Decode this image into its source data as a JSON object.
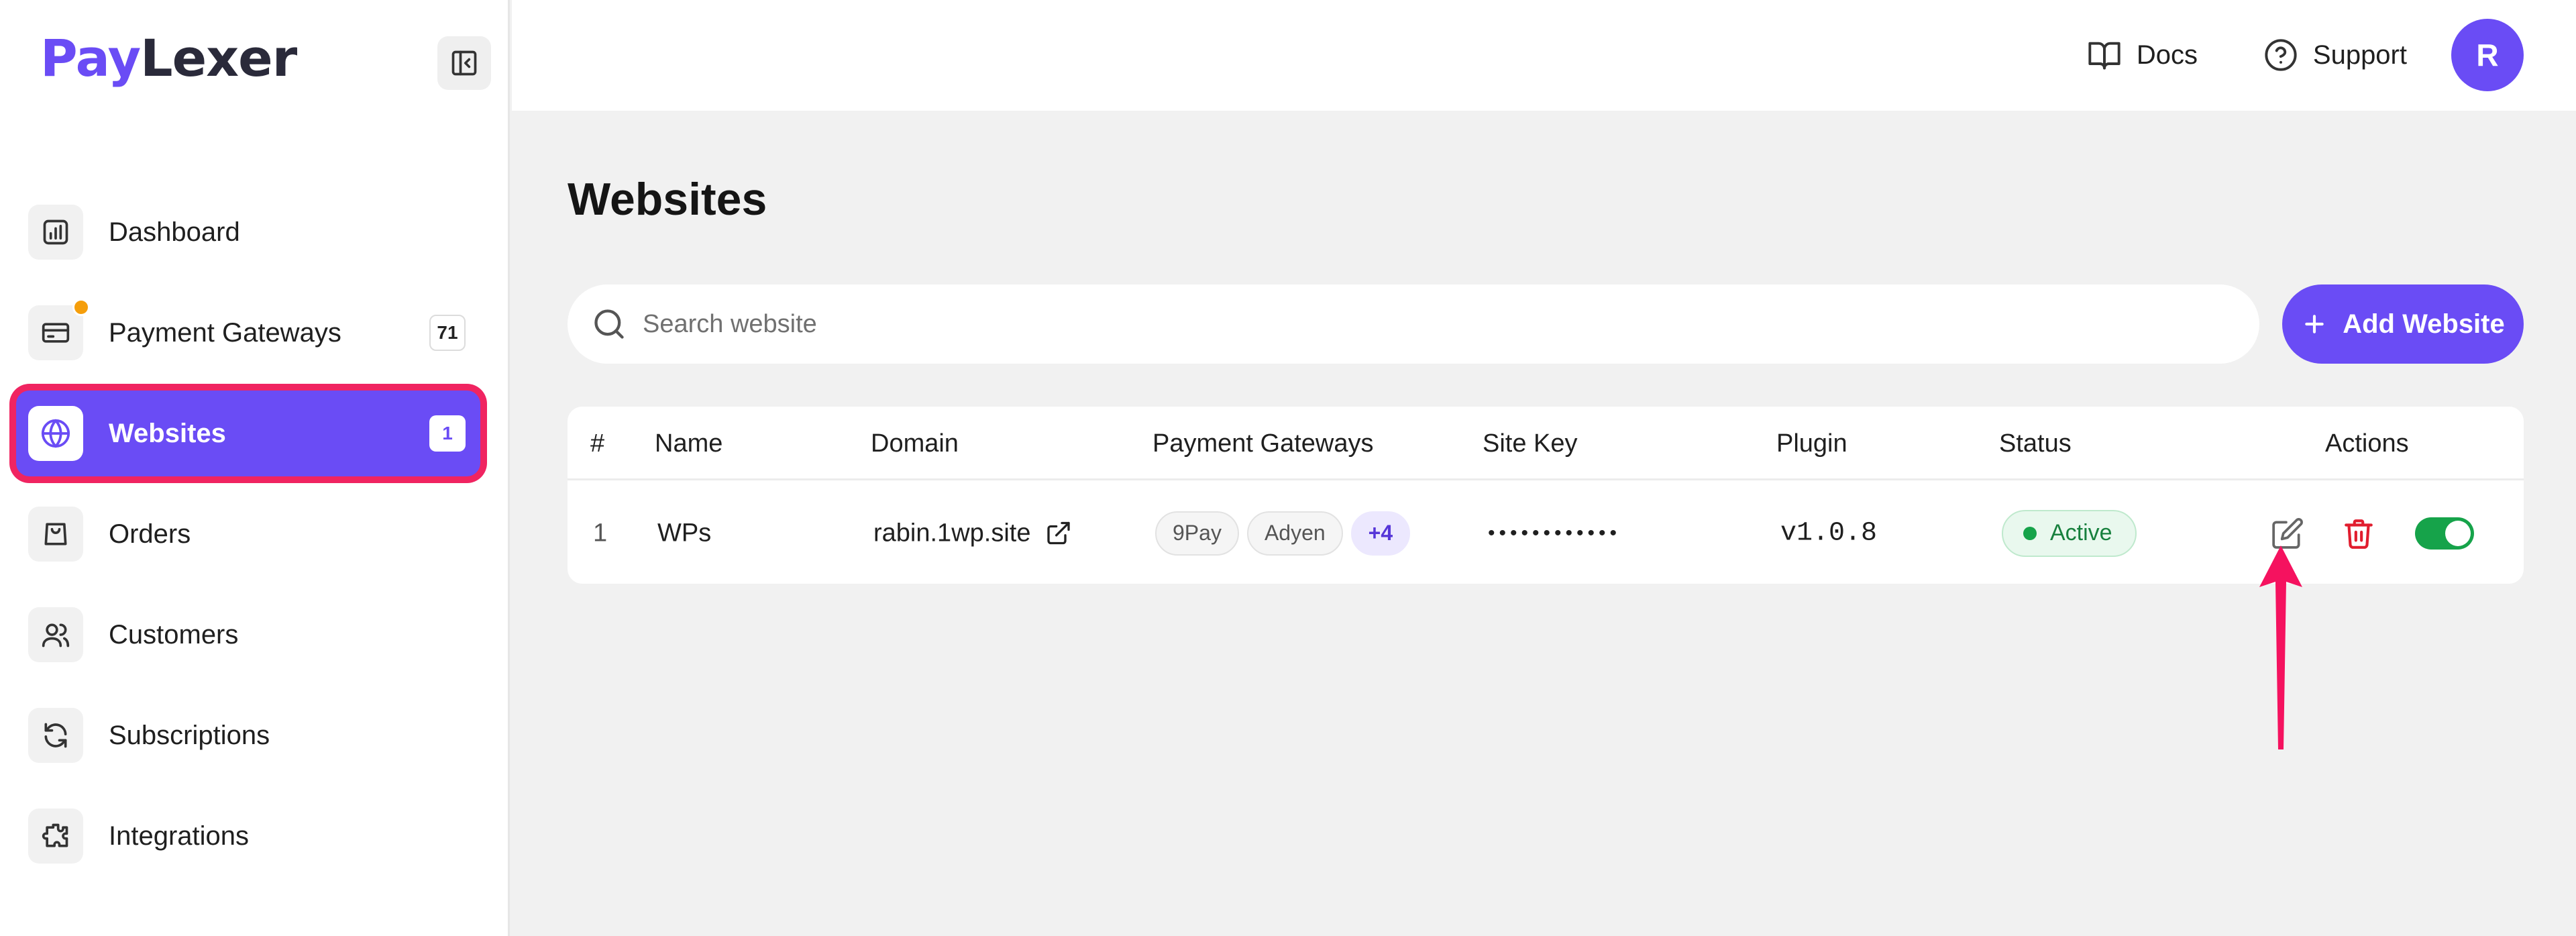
{
  "brand": {
    "pay": "Pay",
    "lexer": "Lexer"
  },
  "sidebar": {
    "items": [
      {
        "label": "Dashboard",
        "icon": "chart-icon"
      },
      {
        "label": "Payment Gateways",
        "icon": "credit-card-icon",
        "badge": "71",
        "notification_dot": true
      },
      {
        "label": "Websites",
        "icon": "globe-icon",
        "badge": "1",
        "active": true
      },
      {
        "label": "Orders",
        "icon": "shopping-bag-icon"
      },
      {
        "label": "Customers",
        "icon": "users-icon"
      },
      {
        "label": "Subscriptions",
        "icon": "refresh-icon"
      },
      {
        "label": "Integrations",
        "icon": "puzzle-icon"
      }
    ]
  },
  "topbar": {
    "docs_label": "Docs",
    "support_label": "Support",
    "avatar_initial": "R"
  },
  "page": {
    "title": "Websites",
    "search_placeholder": "Search website",
    "add_button_label": "Add Website"
  },
  "table": {
    "headers": [
      "#",
      "Name",
      "Domain",
      "Payment Gateways",
      "Site Key",
      "Plugin",
      "Status",
      "Actions"
    ],
    "rows": [
      {
        "index": "1",
        "name": "WPs",
        "domain": "rabin.1wp.site",
        "gateways": [
          "9Pay",
          "Adyen"
        ],
        "gateways_more": "+4",
        "site_key": "••••••••••••",
        "plugin": "v1.0.8",
        "status": "Active",
        "enabled": true
      }
    ]
  },
  "colors": {
    "accent": "#6a4cf5",
    "highlight_outline": "#f02461",
    "success": "#16a34a",
    "danger": "#e11d2e",
    "notification": "#f59e0b"
  }
}
